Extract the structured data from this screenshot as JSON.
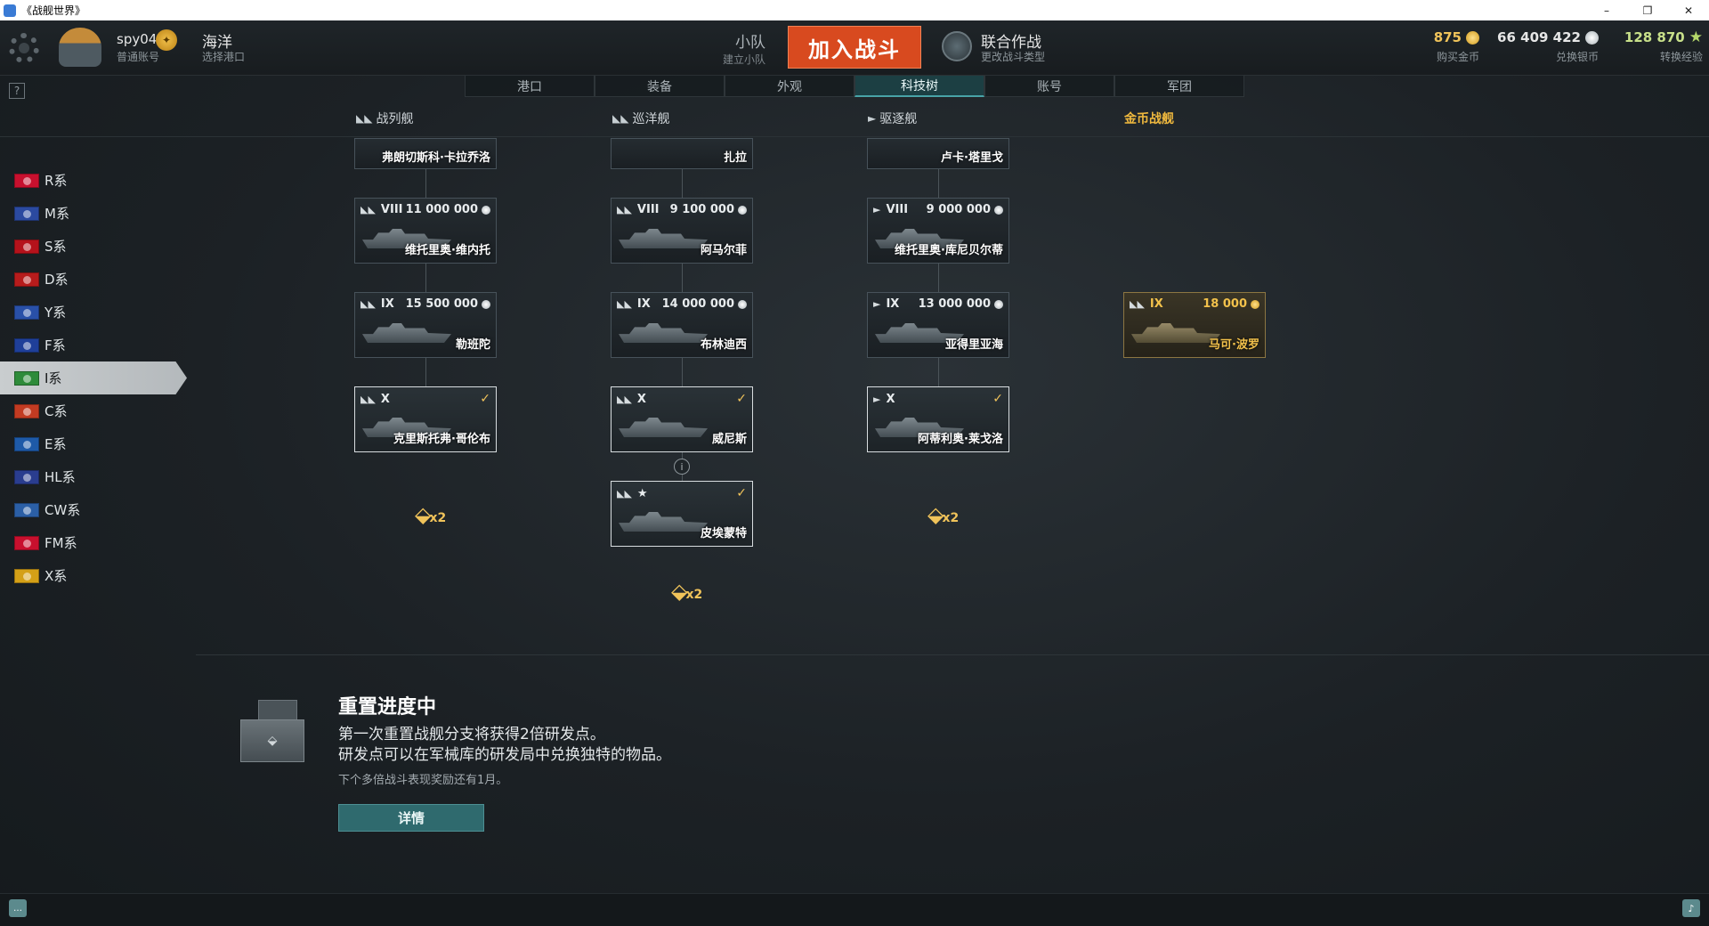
{
  "window": {
    "title": "《战舰世界》",
    "controls": [
      "–",
      "❐",
      "✕"
    ]
  },
  "header": {
    "username": "spy04",
    "account_type": "普通账号",
    "port_name": "海洋",
    "port_hint": "选择港口",
    "division_label": "小队",
    "division_hint": "建立小队",
    "battle_button": "加入战斗",
    "mode_name": "联合作战",
    "mode_hint": "更改战斗类型",
    "gold_value": "875",
    "gold_label": "购买金币",
    "silver_value": "66 409 422",
    "silver_label": "兑换银币",
    "xp_value": "128 870",
    "xp_label": "转换经验",
    "colors": {
      "battle": "#d84a1f",
      "gold": "#f0c35a",
      "xp": "#c8e08a"
    }
  },
  "nav_tabs": [
    "港口",
    "装备",
    "外观",
    "科技树",
    "账号",
    "军团"
  ],
  "active_tab": "科技树",
  "help_label": "?",
  "columns": {
    "battleship": "战列舰",
    "cruiser": "巡洋舰",
    "destroyer": "驱逐舰",
    "premium": "金币战舰"
  },
  "nations": [
    {
      "label": "R系",
      "flag_color": "#c8102e"
    },
    {
      "label": "M系",
      "flag_color": "#2b4aa0"
    },
    {
      "label": "S系",
      "flag_color": "#b5121b"
    },
    {
      "label": "D系",
      "flag_color": "#b71c1c"
    },
    {
      "label": "Y系",
      "flag_color": "#2950a8"
    },
    {
      "label": "F系",
      "flag_color": "#1f3f99"
    },
    {
      "label": "I系",
      "flag_color": "#2e8b3a"
    },
    {
      "label": "C系",
      "flag_color": "#c23b22"
    },
    {
      "label": "E系",
      "flag_color": "#1e5aa8"
    },
    {
      "label": "HL系",
      "flag_color": "#2a3d8f"
    },
    {
      "label": "CW系",
      "flag_color": "#2b5fa6"
    },
    {
      "label": "FM系",
      "flag_color": "#c8102e"
    },
    {
      "label": "X系",
      "flag_color": "#d4a017"
    }
  ],
  "active_nation": "I系",
  "ships": {
    "bb7": {
      "name": "弗朗切斯科·卡拉乔洛"
    },
    "ca7": {
      "name": "扎拉"
    },
    "dd7": {
      "name": "卢卡·塔里戈"
    },
    "bb8": {
      "class": "◣◣",
      "tier": "VIII",
      "cost": "11 000 000",
      "name": "维托里奥·维内托"
    },
    "ca8": {
      "class": "◣◣",
      "tier": "VIII",
      "cost": "9 100 000",
      "name": "阿马尔菲"
    },
    "dd8": {
      "class": "►",
      "tier": "VIII",
      "cost": "9 000 000",
      "name": "维托里奥·库尼贝尔蒂"
    },
    "bb9": {
      "class": "◣◣",
      "tier": "IX",
      "cost": "15 500 000",
      "name": "勒班陀"
    },
    "ca9": {
      "class": "◣◣",
      "tier": "IX",
      "cost": "14 000 000",
      "name": "布林迪西"
    },
    "dd9": {
      "class": "►",
      "tier": "IX",
      "cost": "13 000 000",
      "name": "亚得里亚海"
    },
    "prem9": {
      "class": "◣◣",
      "tier": "IX",
      "cost": "18 000",
      "name": "马可·波罗"
    },
    "bb10": {
      "class": "◣◣",
      "tier": "X",
      "check": "✓",
      "name": "克里斯托弗·哥伦布"
    },
    "ca10": {
      "class": "◣◣",
      "tier": "X",
      "check": "✓",
      "name": "威尼斯"
    },
    "dd10": {
      "class": "►",
      "tier": "X",
      "check": "✓",
      "name": "阿蒂利奥·莱戈洛"
    },
    "ca_super": {
      "class": "◣◣",
      "tier": "★",
      "check": "✓",
      "name": "皮埃蒙特"
    }
  },
  "info_label": "i",
  "bonus": {
    "icon": "⬙",
    "multiplier": "x2"
  },
  "reset": {
    "title": "重置进度中",
    "line1": "第一次重置战舰分支将获得2倍研发点。",
    "line2": "研发点可以在军械库的研发局中兑换独特的物品。",
    "note": "下个多倍战斗表现奖励还有1月。",
    "details_button": "详情",
    "box_glyph": "⬙"
  },
  "bottom": {
    "chat_glyph": "…",
    "notif_glyph": "♪"
  }
}
